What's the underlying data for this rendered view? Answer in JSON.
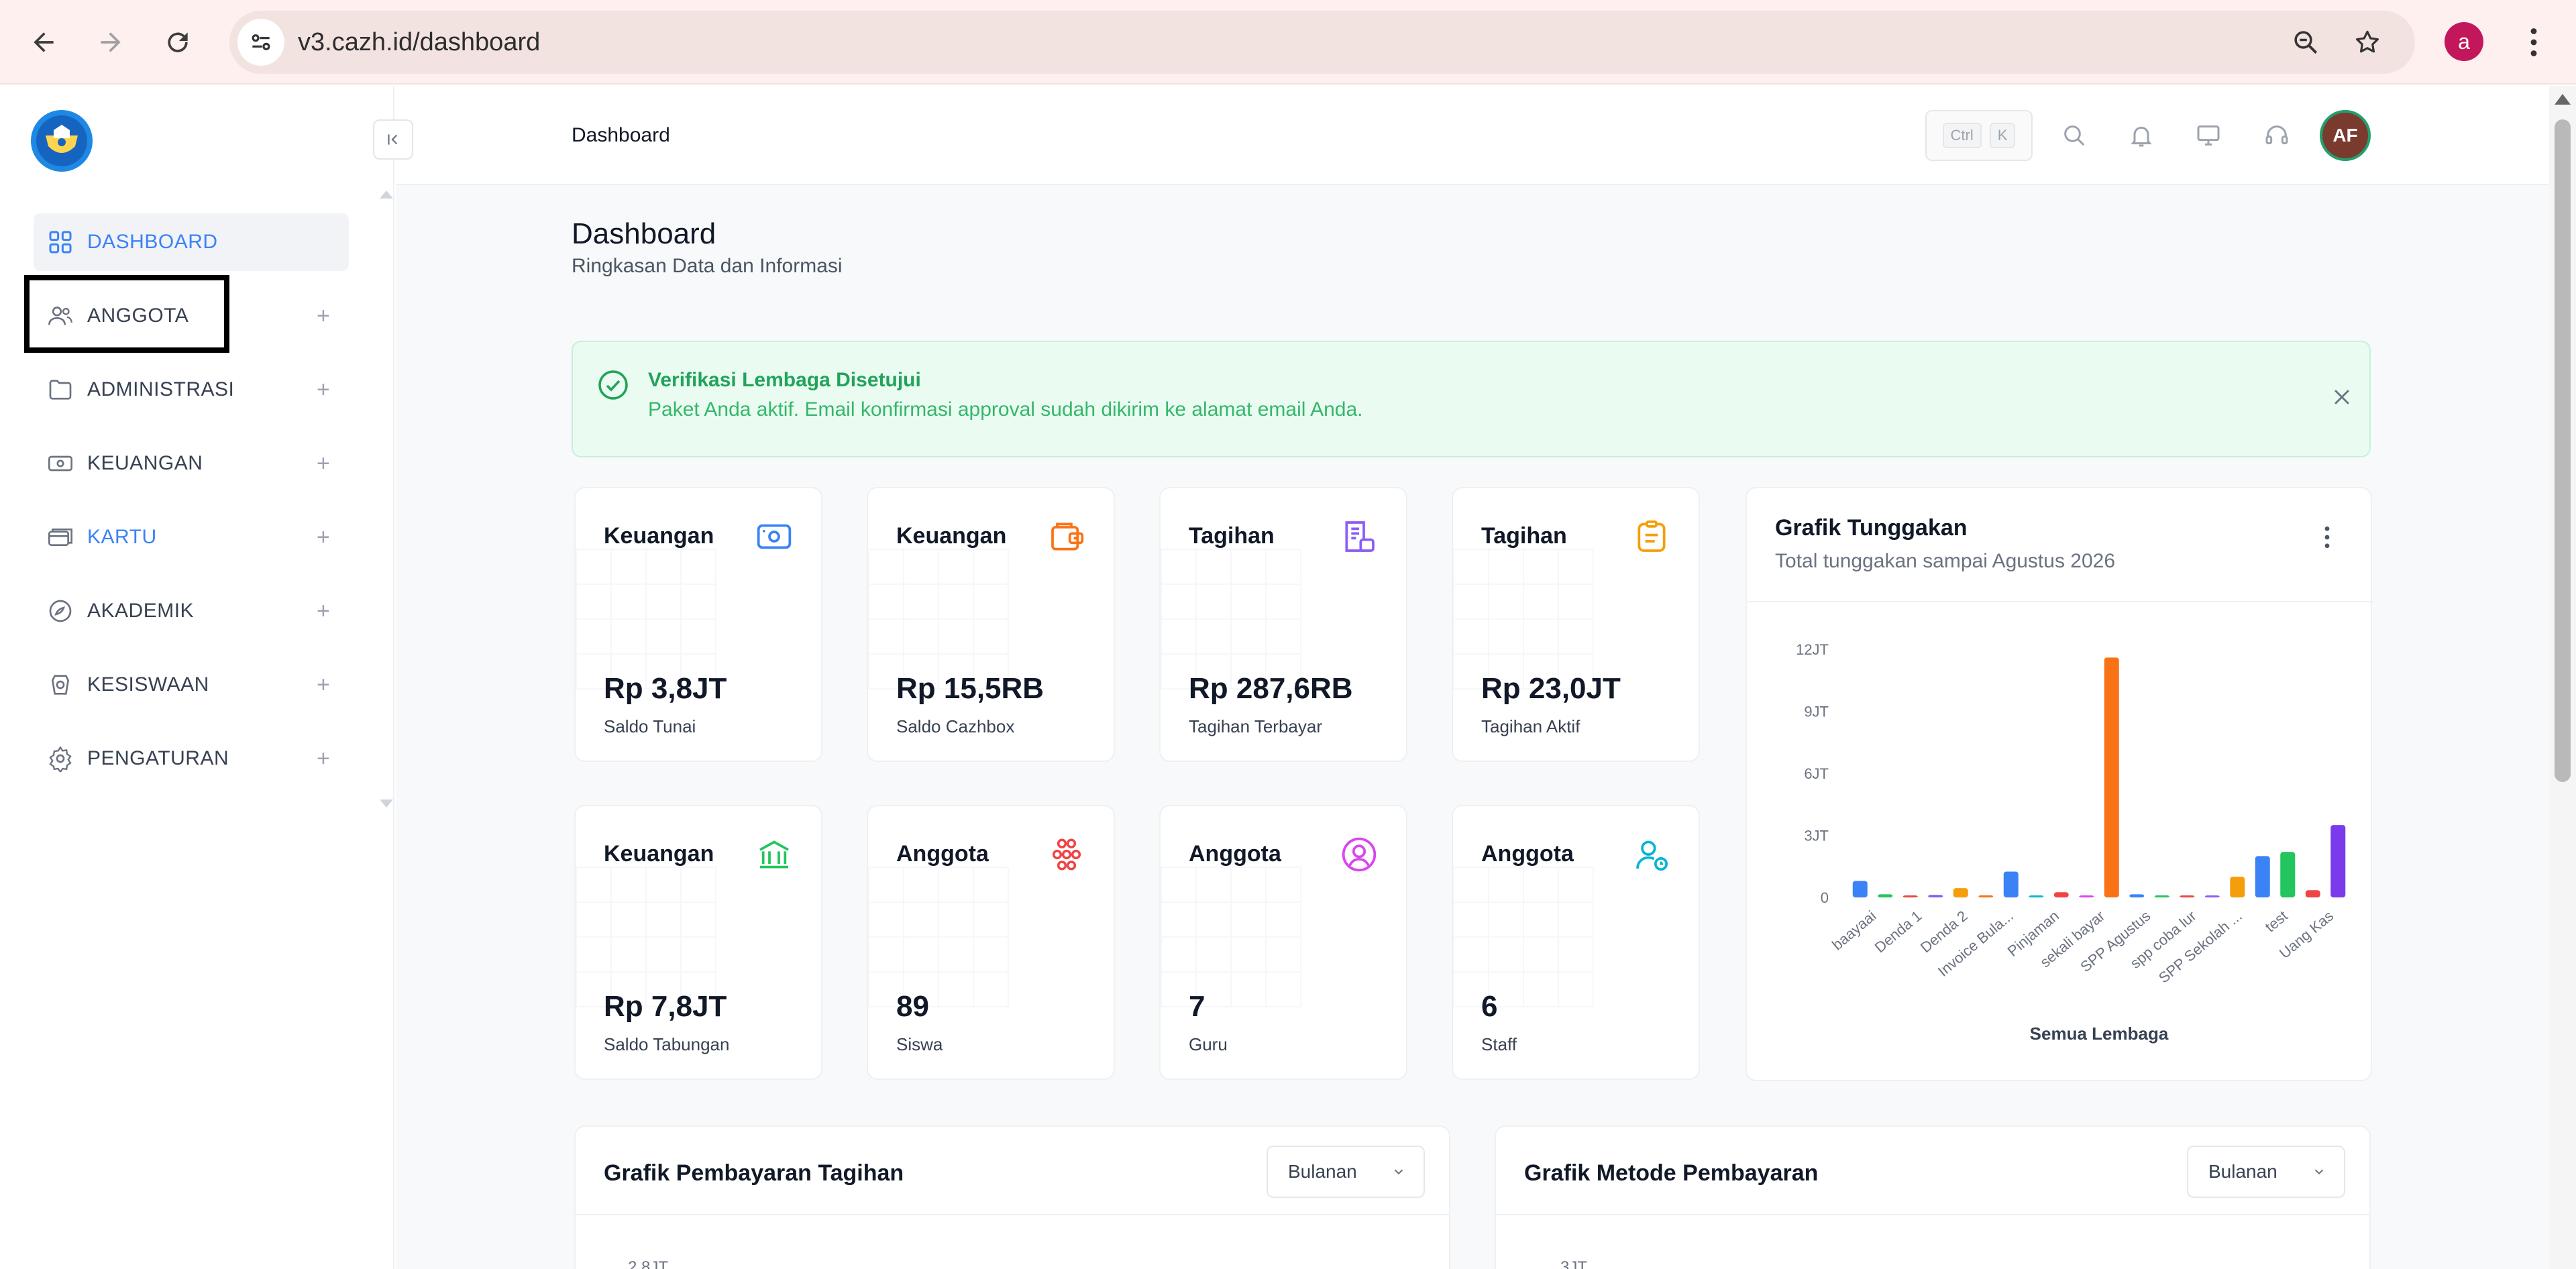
{
  "browser": {
    "url": "v3.cazh.id/dashboard",
    "profile_initial": "a"
  },
  "sidebar": {
    "items": [
      {
        "label": "DASHBOARD",
        "icon": "dashboard-grid-icon"
      },
      {
        "label": "ANGGOTA",
        "icon": "users-icon"
      },
      {
        "label": "ADMINISTRASI",
        "icon": "folder-icon"
      },
      {
        "label": "KEUANGAN",
        "icon": "money-icon"
      },
      {
        "label": "KARTU",
        "icon": "card-icon"
      },
      {
        "label": "AKADEMIK",
        "icon": "academic-icon"
      },
      {
        "label": "KESISWAAN",
        "icon": "student-icon"
      },
      {
        "label": "PENGATURAN",
        "icon": "gear-icon"
      }
    ]
  },
  "topbar": {
    "breadcrumb": "Dashboard",
    "kbd_ctrl": "Ctrl",
    "kbd_k": "K",
    "avatar_initials": "AF"
  },
  "page": {
    "title": "Dashboard",
    "subtitle": "Ringkasan Data dan Informasi"
  },
  "alert": {
    "title": "Verifikasi Lembaga Disetujui",
    "message": "Paket Anda aktif. Email konfirmasi approval sudah dikirim ke alamat email Anda."
  },
  "stats": [
    {
      "title": "Keuangan",
      "value": "Rp 3,8JT",
      "label": "Saldo Tunai",
      "icon": "wallet-icon",
      "color": "#3b82f6"
    },
    {
      "title": "Keuangan",
      "value": "Rp 15,5RB",
      "label": "Saldo Cazhbox",
      "icon": "purse-icon",
      "color": "#f97316"
    },
    {
      "title": "Tagihan",
      "value": "Rp 287,6RB",
      "label": "Tagihan Terbayar",
      "icon": "invoice-paid-icon",
      "color": "#8b5cf6"
    },
    {
      "title": "Tagihan",
      "value": "Rp 23,0JT",
      "label": "Tagihan Aktif",
      "icon": "clipboard-icon",
      "color": "#f59e0b"
    },
    {
      "title": "Keuangan",
      "value": "Rp 7,8JT",
      "label": "Saldo Tabungan",
      "icon": "bank-icon",
      "color": "#22c55e"
    },
    {
      "title": "Anggota",
      "value": "89",
      "label": "Siswa",
      "icon": "students-group-icon",
      "color": "#ef4444"
    },
    {
      "title": "Anggota",
      "value": "7",
      "label": "Guru",
      "icon": "teacher-icon",
      "color": "#d946ef"
    },
    {
      "title": "Anggota",
      "value": "6",
      "label": "Staff",
      "icon": "staff-icon",
      "color": "#06b6d4"
    }
  ],
  "tunggakan": {
    "title": "Grafik Tunggakan",
    "subtitle": "Total tunggakan sampai Agustus 2026",
    "xlabel": "Semua Lembaga"
  },
  "chart_data": [
    {
      "type": "bar",
      "title": "Grafik Tunggakan",
      "subtitle": "Total tunggakan sampai Agustus 2026",
      "xlabel": "Semua Lembaga",
      "ylabel": "",
      "ylim": [
        0,
        12000000
      ],
      "yticks": [
        "0",
        "3JT",
        "6JT",
        "9JT",
        "12JT"
      ],
      "ytick_values": [
        0,
        3000000,
        6000000,
        9000000,
        12000000
      ],
      "categories": [
        "baayaai",
        "Denda 1",
        "Denda 2",
        "Invoice Bula...",
        "Pinjaman",
        "sekali bayar",
        "SPP Agustus",
        "spp coba lur",
        "SPP Sekolah ...",
        "test",
        "Uang Kas"
      ],
      "bars": [
        {
          "value": 800000,
          "color": "#3b82f6"
        },
        {
          "value": 150000,
          "color": "#22c55e"
        },
        {
          "value": 80000,
          "color": "#ef4444"
        },
        {
          "value": 120000,
          "color": "#8b5cf6"
        },
        {
          "value": 450000,
          "color": "#f59e0b"
        },
        {
          "value": 100000,
          "color": "#f97316"
        },
        {
          "value": 1250000,
          "color": "#3b82f6"
        },
        {
          "value": 60000,
          "color": "#06b6d4"
        },
        {
          "value": 250000,
          "color": "#ef4444"
        },
        {
          "value": 80000,
          "color": "#d946ef"
        },
        {
          "value": 11600000,
          "color": "#f97316"
        },
        {
          "value": 150000,
          "color": "#3b82f6"
        },
        {
          "value": 100000,
          "color": "#22c55e"
        },
        {
          "value": 0,
          "color": "#ef4444"
        },
        {
          "value": 0,
          "color": "#8b5cf6"
        },
        {
          "value": 1000000,
          "color": "#f59e0b"
        },
        {
          "value": 2000000,
          "color": "#3b82f6"
        },
        {
          "value": 2200000,
          "color": "#22c55e"
        },
        {
          "value": 350000,
          "color": "#ef4444"
        },
        {
          "value": 3500000,
          "color": "#7c3aed"
        }
      ],
      "grid": false
    }
  ],
  "bottom_cards": [
    {
      "title": "Grafik Pembayaran Tagihan",
      "select": "Bulanan",
      "ytick_top": "2.8JT"
    },
    {
      "title": "Grafik Metode Pembayaran",
      "select": "Bulanan",
      "ytick_top": "3JT"
    }
  ]
}
